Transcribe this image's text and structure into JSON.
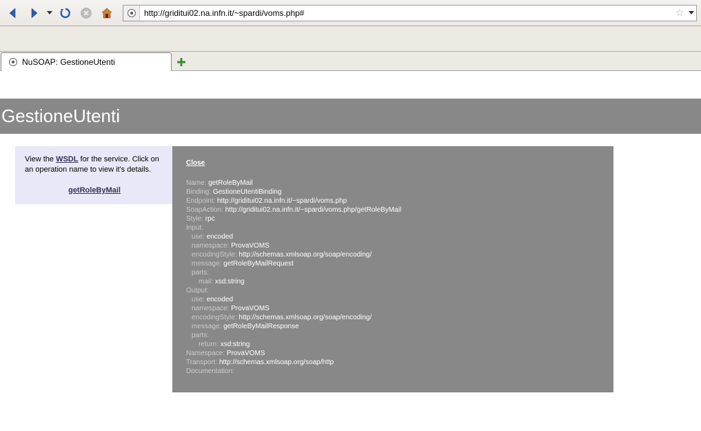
{
  "browser": {
    "url": "http://griditui02.na.infn.it/~spardi/voms.php#",
    "tab_title": "NuSOAP: GestioneUtenti"
  },
  "page": {
    "title": "GestioneUtenti",
    "info_prefix": "View the ",
    "wsdl_link": "WSDL",
    "info_suffix": " for the service. Click on an operation name to view it's details.",
    "operation_link": "getRoleByMail"
  },
  "detail": {
    "close": "Close",
    "name_label": "Name: ",
    "name_value": "getRoleByMail",
    "binding_label": "Binding: ",
    "binding_value": "GestioneUtentiBinding",
    "endpoint_label": "Endpoint: ",
    "endpoint_value": "http://griditui02.na.infn.it/~spardi/voms.php",
    "soapaction_label": "SoapAction: ",
    "soapaction_value": "http://griditui02.na.infn.it/~spardi/voms.php/getRoleByMail",
    "style_label": "Style: ",
    "style_value": "rpc",
    "input_label": "Input:",
    "input_use_label": "use: ",
    "input_use_value": "encoded",
    "input_ns_label": "namespace: ",
    "input_ns_value": "ProvaVOMS",
    "input_enc_label": "encodingStyle: ",
    "input_enc_value": "http://schemas.xmlsoap.org/soap/encoding/",
    "input_msg_label": "message: ",
    "input_msg_value": "getRoleByMailRequest",
    "input_parts_label": "parts:",
    "input_part1_label": "mail: ",
    "input_part1_value": "xsd:string",
    "output_label": "Output:",
    "output_use_label": "use: ",
    "output_use_value": "encoded",
    "output_ns_label": "namespace: ",
    "output_ns_value": "ProvaVOMS",
    "output_enc_label": "encodingStyle: ",
    "output_enc_value": "http://schemas.xmlsoap.org/soap/encoding/",
    "output_msg_label": "message: ",
    "output_msg_value": "getRoleByMailResponse",
    "output_parts_label": "parts:",
    "output_part1_label": "return: ",
    "output_part1_value": "xsd:string",
    "namespace_label": "Namespace: ",
    "namespace_value": "ProvaVOMS",
    "transport_label": "Transport: ",
    "transport_value": "http://schemas.xmlsoap.org/soap/http",
    "documentation_label": "Documentation: "
  }
}
